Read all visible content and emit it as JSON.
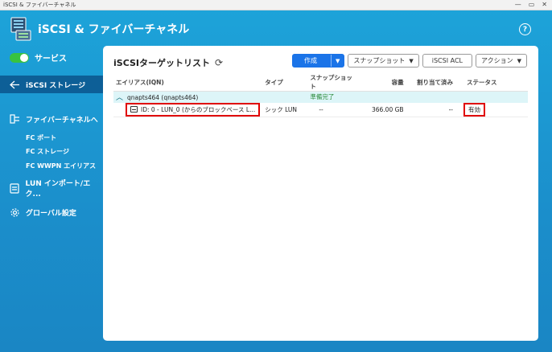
{
  "window": {
    "title": "iSCSI & ファイバーチャネル",
    "controls": [
      "—",
      "▭",
      "✕"
    ]
  },
  "app": {
    "title": "iSCSI & ファイバーチャネル",
    "help": "?"
  },
  "sidebar": {
    "service_label": "サービス",
    "items": [
      {
        "label": "iSCSI ストレージ",
        "icon": "iscsi-storage-icon",
        "active": true
      },
      {
        "label": "ファイバーチャネルへ",
        "icon": "fibre-channel-icon"
      },
      {
        "label": "LUN インポート/エク...",
        "icon": "lun-import-icon"
      },
      {
        "label": "グローバル設定",
        "icon": "gear-icon"
      }
    ],
    "fc_subitems": [
      "FC ポート",
      "FC ストレージ",
      "FC WWPN エイリアス"
    ]
  },
  "main": {
    "title": "iSCSIターゲットリスト",
    "toolbar": {
      "create": "作成",
      "snapshot": "スナップショット",
      "acl": "iSCSI ACL",
      "action": "アクション"
    },
    "columns": [
      "エイリアス(IQN)",
      "タイプ",
      "スナップショット",
      "容量",
      "割り当て済み",
      "ステータス"
    ],
    "group": {
      "name": "qnapts464 (qnapts464)",
      "status": "準備完了"
    },
    "rows": [
      {
        "alias": "ID: 0 - LUN_0 (からのブロックベース L...",
        "type": "シック LUN",
        "snapshot": "--",
        "capacity": "366.00 GB",
        "allocated": "--",
        "status": "有効"
      }
    ]
  },
  "colors": {
    "accent": "#1b74e8",
    "sidebar_active": "#0d5f97",
    "highlight": "#e00000",
    "toggle_on": "#38c33f"
  }
}
